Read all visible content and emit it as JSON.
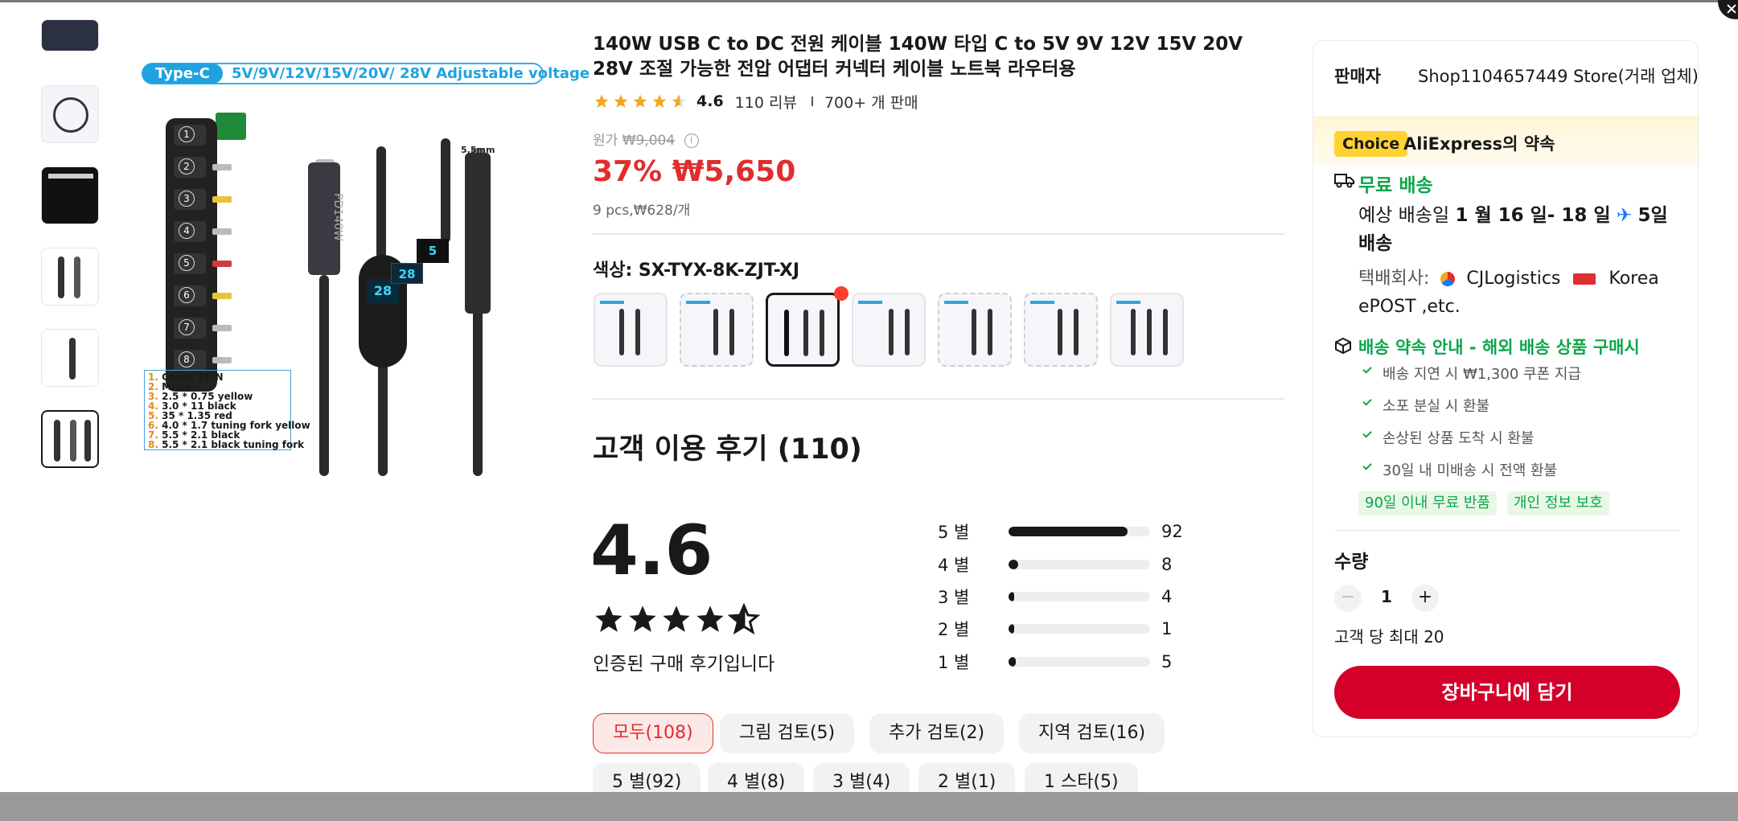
{
  "main_image": {
    "typec_tag": "Type-C",
    "voltage_text": "5V/9V/12V/15V/20V/ 28V Adjustable voltage",
    "size_label": "5.5mm",
    "pd_label": "PD140W",
    "lcd_1": "28",
    "lcd_2": "28",
    "lcd_3": "5",
    "legend": [
      {
        "num": "1.",
        "text": "Green 2PIN"
      },
      {
        "num": "2.",
        "text": "Micro"
      },
      {
        "num": "3.",
        "text": "2.5 * 0.75 yellow"
      },
      {
        "num": "4.",
        "text": "3.0 * 11 black"
      },
      {
        "num": "5.",
        "text": "35 * 1.35 red"
      },
      {
        "num": "6.",
        "text": "4.0 * 1.7 tuning fork yellow"
      },
      {
        "num": "7.",
        "text": "5.5 * 2.1 black"
      },
      {
        "num": "8.",
        "text": "5.5 * 2.1 black tuning fork"
      }
    ]
  },
  "product": {
    "title": "140W USB C to DC 전원 케이블 140W 타입 C to 5V 9V 12V 15V 20V 28V 조절 가능한 전압 어댑터 커넥터 케이블 노트북 라우터용",
    "rating": "4.6",
    "reviews": "110 리뷰",
    "sold": "700+ 개 판매",
    "original_price_label": "원가",
    "original_price": "₩9,004",
    "info_icon": "i",
    "discount_price": "37% ₩5,650",
    "pcs_price": "9 pcs,₩628/개",
    "color_label": "색상: SX-TYX-8K-ZJT-XJ"
  },
  "reviews": {
    "title": "고객 이용 후기 (110)",
    "score": "4.6",
    "score_value": 4.6,
    "verified": "인증된 구매 후기입니다",
    "distribution": [
      {
        "label": "5 별",
        "count": "92",
        "fraction": 0.84
      },
      {
        "label": "4 별",
        "count": "8",
        "fraction": 0.07
      },
      {
        "label": "3 별",
        "count": "4",
        "fraction": 0.04
      },
      {
        "label": "2 별",
        "count": "1",
        "fraction": 0.01
      },
      {
        "label": "1 별",
        "count": "5",
        "fraction": 0.05
      }
    ],
    "filters": [
      "모두(108)",
      "그림 검토(5)",
      "추가 검토(2)",
      "지역 검토(16)",
      "5 별(92)",
      "4 별(8)",
      "3 별(4)",
      "2 별(1)",
      "1 스타(5)"
    ]
  },
  "seller": {
    "label": "판매자",
    "name": "Shop1104657449 Store(거래 업체)"
  },
  "choice": {
    "tag": "Choice",
    "text": "AliExpress의 약속"
  },
  "shipping": {
    "free": "무료 배송",
    "est_prefix": "예상 배송일",
    "est_dates": "1 월 16 일- 18 일",
    "plane_icon": "✈",
    "est_days": "5일 배송",
    "courier_label": "택배회사:",
    "courier_cj": "CJLogistics",
    "courier_kp": "Korea ePOST ,etc."
  },
  "pledge": {
    "title": "배송 약속 안내 - 해외 배송 상품 구매시",
    "items": [
      "배송 지연 시 ₩1,300 쿠폰 지급",
      "소포 분실 시 환불",
      "손상된 상품 도착 시 환불",
      "30일 내 미배송 시 전액 환불"
    ],
    "chips": [
      "90일 이내 무료 반품",
      "개인 정보 보호"
    ]
  },
  "quantity": {
    "label": "수량",
    "minus": "−",
    "value": "1",
    "plus": "+",
    "max": "고객 당 최대 20"
  },
  "cart_button": "장바구니에 담기",
  "colors": {
    "price_red": "#e02d2d",
    "green": "#0ca64a",
    "cart_red": "#d4002a",
    "star_orange": "#f5a623",
    "choice_yellow": "#ffd234"
  }
}
